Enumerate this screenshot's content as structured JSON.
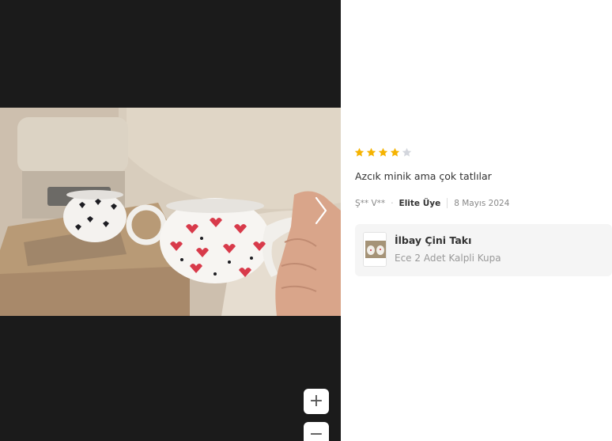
{
  "review": {
    "rating": 4,
    "max_rating": 5,
    "star_color": "#f5b301",
    "empty_star_color": "#d3d6dd",
    "text": "Azcık minik ama çok tatlılar",
    "reviewer": "Ş** V**",
    "badge": "Elite Üye",
    "date": "8 Mayıs 2024"
  },
  "product": {
    "seller": "İlbay Çini Takı",
    "name": "Ece 2 Adet Kalpli Kupa"
  },
  "viewer": {
    "zoom_in_label": "+",
    "zoom_out_label": "−",
    "next_icon": "chevron-right-icon"
  }
}
